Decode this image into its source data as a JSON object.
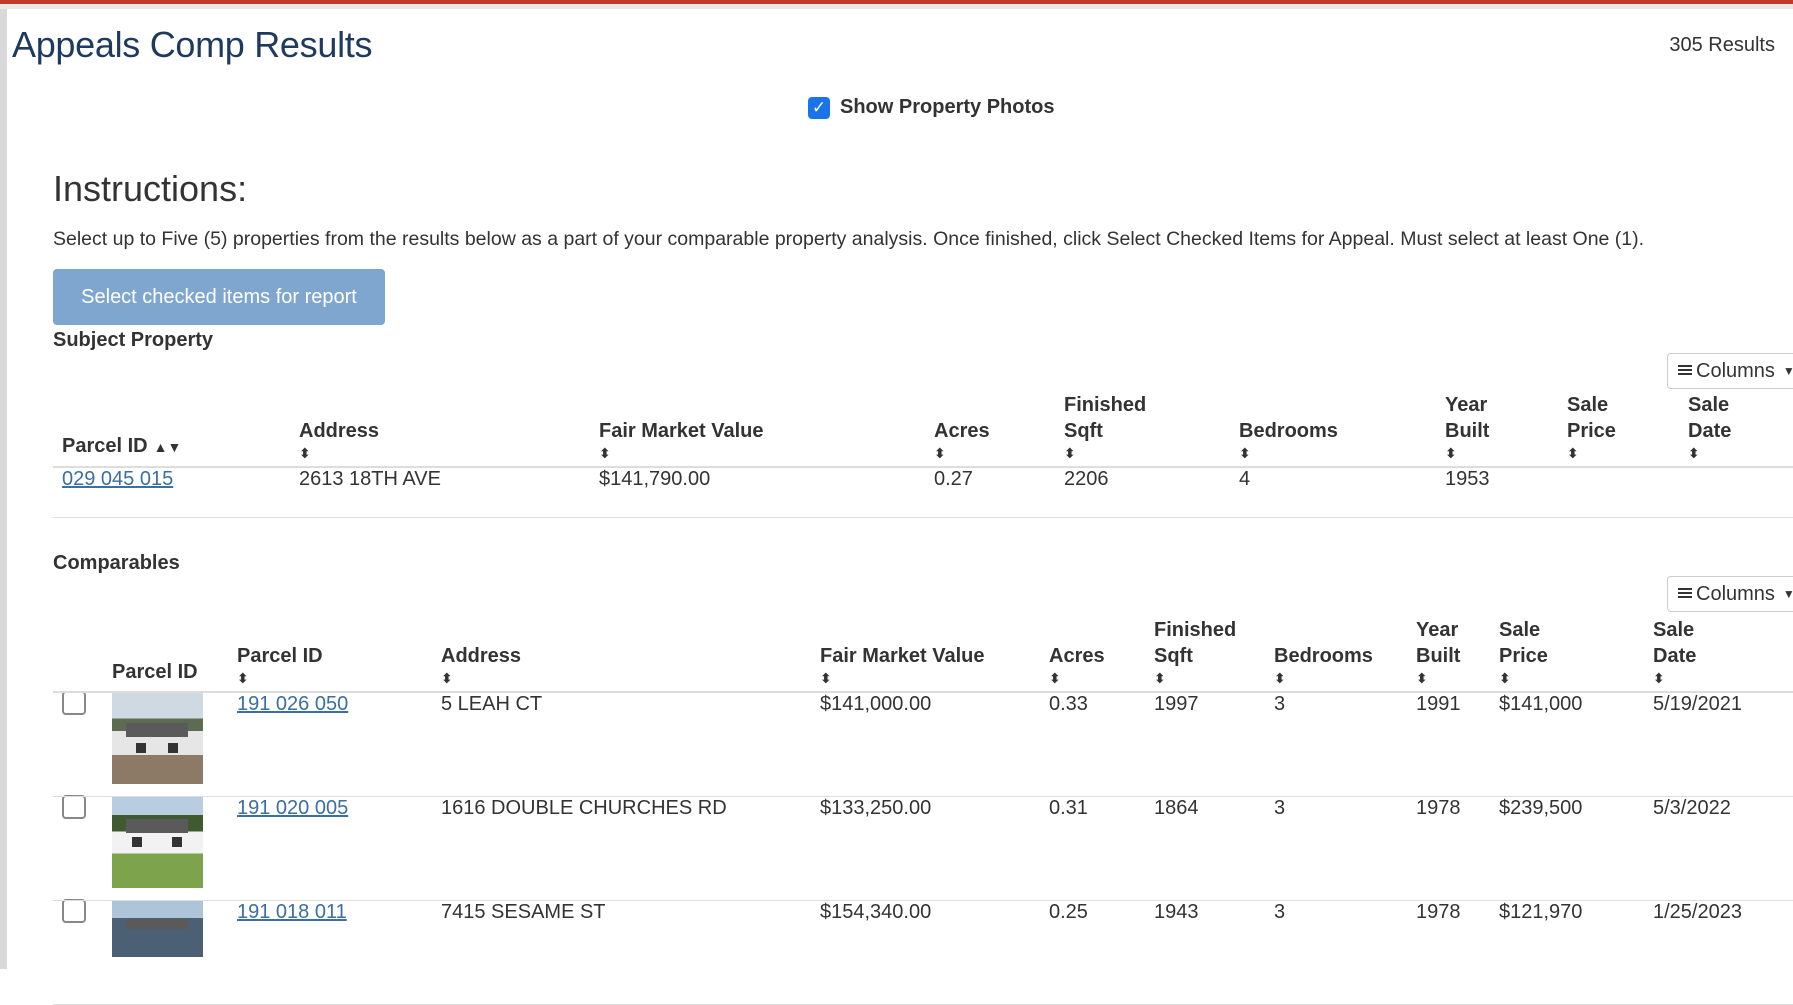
{
  "page": {
    "title": "Appeals Comp Results",
    "results_count": "305 Results",
    "show_photos_label": "Show Property Photos",
    "show_photos_checked": true
  },
  "instructions": {
    "heading": "Instructions:",
    "text": "Select up to Five (5) properties from the results below as a part of your comparable property analysis. Once finished, click Select Checked Items for Appeal. Must select at least One (1).",
    "button_label": "Select checked items for report"
  },
  "subject": {
    "label": "Subject Property",
    "columns_button": "Columns",
    "headers": {
      "parcel_id": "Parcel ID",
      "address": "Address",
      "fmv": "Fair Market Value",
      "acres": "Acres",
      "sqft_1": "Finished",
      "sqft_2": "Sqft",
      "bedrooms": "Bedrooms",
      "year_1": "Year",
      "year_2": "Built",
      "price_1": "Sale",
      "price_2": "Price",
      "date_1": "Sale",
      "date_2": "Date"
    },
    "row": {
      "parcel_id": "029 045 015",
      "address": "2613 18TH AVE",
      "fmv": "$141,790.00",
      "acres": "0.27",
      "sqft": "2206",
      "bedrooms": "4",
      "year": "1953",
      "price": "",
      "date": ""
    }
  },
  "comparables": {
    "label": "Comparables",
    "columns_button": "Columns",
    "headers": {
      "photo": "Parcel ID",
      "parcel_id": "Parcel ID",
      "address": "Address",
      "fmv": "Fair Market Value",
      "acres": "Acres",
      "sqft_1": "Finished",
      "sqft_2": "Sqft",
      "bedrooms": "Bedrooms",
      "year_1": "Year",
      "year_2": "Built",
      "price_1": "Sale",
      "price_2": "Price",
      "date_1": "Sale",
      "date_2": "Date"
    },
    "rows": [
      {
        "parcel_id": "191 026 050",
        "address": "5 LEAH CT",
        "fmv": "$141,000.00",
        "acres": "0.33",
        "sqft": "1997",
        "bedrooms": "3",
        "year": "1991",
        "price": "$141,000",
        "date": "5/19/2021"
      },
      {
        "parcel_id": "191 020 005",
        "address": "1616 DOUBLE CHURCHES RD",
        "fmv": "$133,250.00",
        "acres": "0.31",
        "sqft": "1864",
        "bedrooms": "3",
        "year": "1978",
        "price": "$239,500",
        "date": "5/3/2022"
      },
      {
        "parcel_id": "191 018 011",
        "address": "7415 SESAME ST",
        "fmv": "$154,340.00",
        "acres": "0.25",
        "sqft": "1943",
        "bedrooms": "3",
        "year": "1978",
        "price": "$121,970",
        "date": "1/25/2023"
      }
    ]
  }
}
